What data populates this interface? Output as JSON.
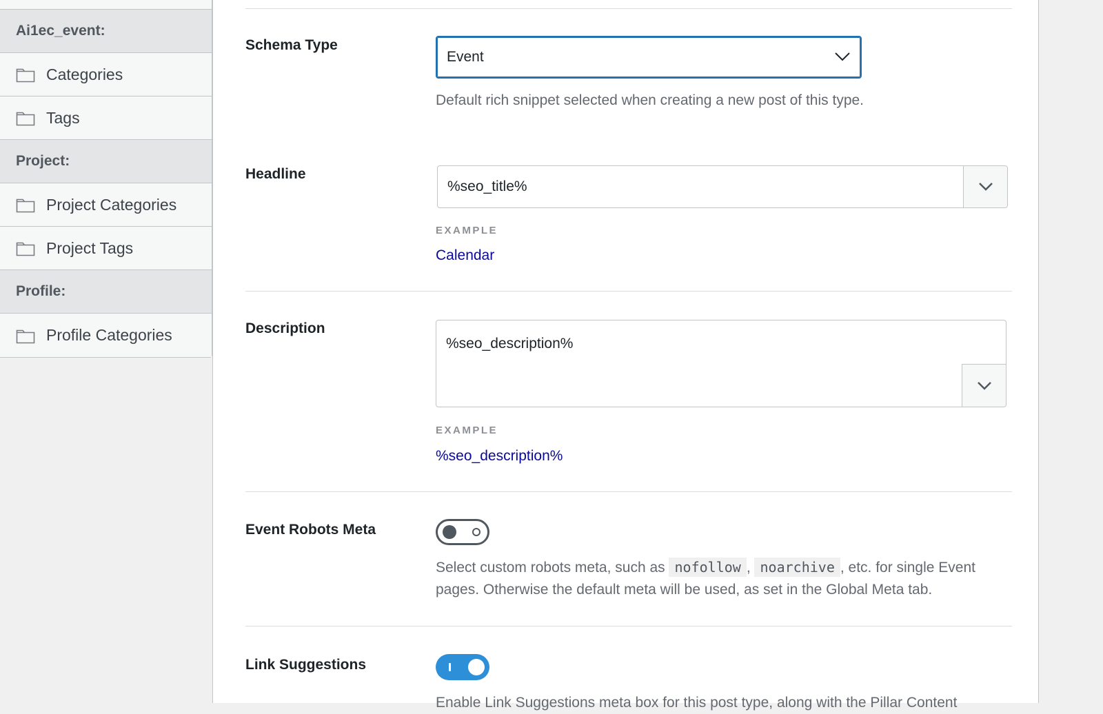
{
  "sidebar": {
    "groups": [
      {
        "title": "Ai1ec_event:",
        "items": [
          "Categories",
          "Tags"
        ]
      },
      {
        "title": "Project:",
        "items": [
          "Project Categories",
          "Project Tags"
        ]
      },
      {
        "title": "Profile:",
        "items": [
          "Profile Categories"
        ]
      }
    ]
  },
  "schema_type": {
    "label": "Schema Type",
    "value": "Event",
    "help": "Default rich snippet selected when creating a new post of this type."
  },
  "headline": {
    "label": "Headline",
    "value": "%seo_title%",
    "example_label": "EXAMPLE",
    "example_value": "Calendar"
  },
  "description": {
    "label": "Description",
    "value": "%seo_description%",
    "example_label": "EXAMPLE",
    "example_value": "%seo_description%"
  },
  "robots_meta": {
    "label": "Event Robots Meta",
    "enabled": false,
    "help_prefix": "Select custom robots meta, such as ",
    "code1": "nofollow",
    "sep": ", ",
    "code2": "noarchive",
    "help_suffix": ", etc. for single Event pages. Otherwise the default meta will be used, as set in the Global Meta tab."
  },
  "link_suggestions": {
    "label": "Link Suggestions",
    "enabled": true,
    "help": "Enable Link Suggestions meta box for this post type, along with the Pillar Content"
  },
  "colors": {
    "accent": "#2271b1",
    "toggle_on": "#2e8fd9",
    "example_link": "#0a0a9a"
  },
  "icons": {
    "folder": "folder-icon",
    "chevron": "chevron-down-icon"
  }
}
